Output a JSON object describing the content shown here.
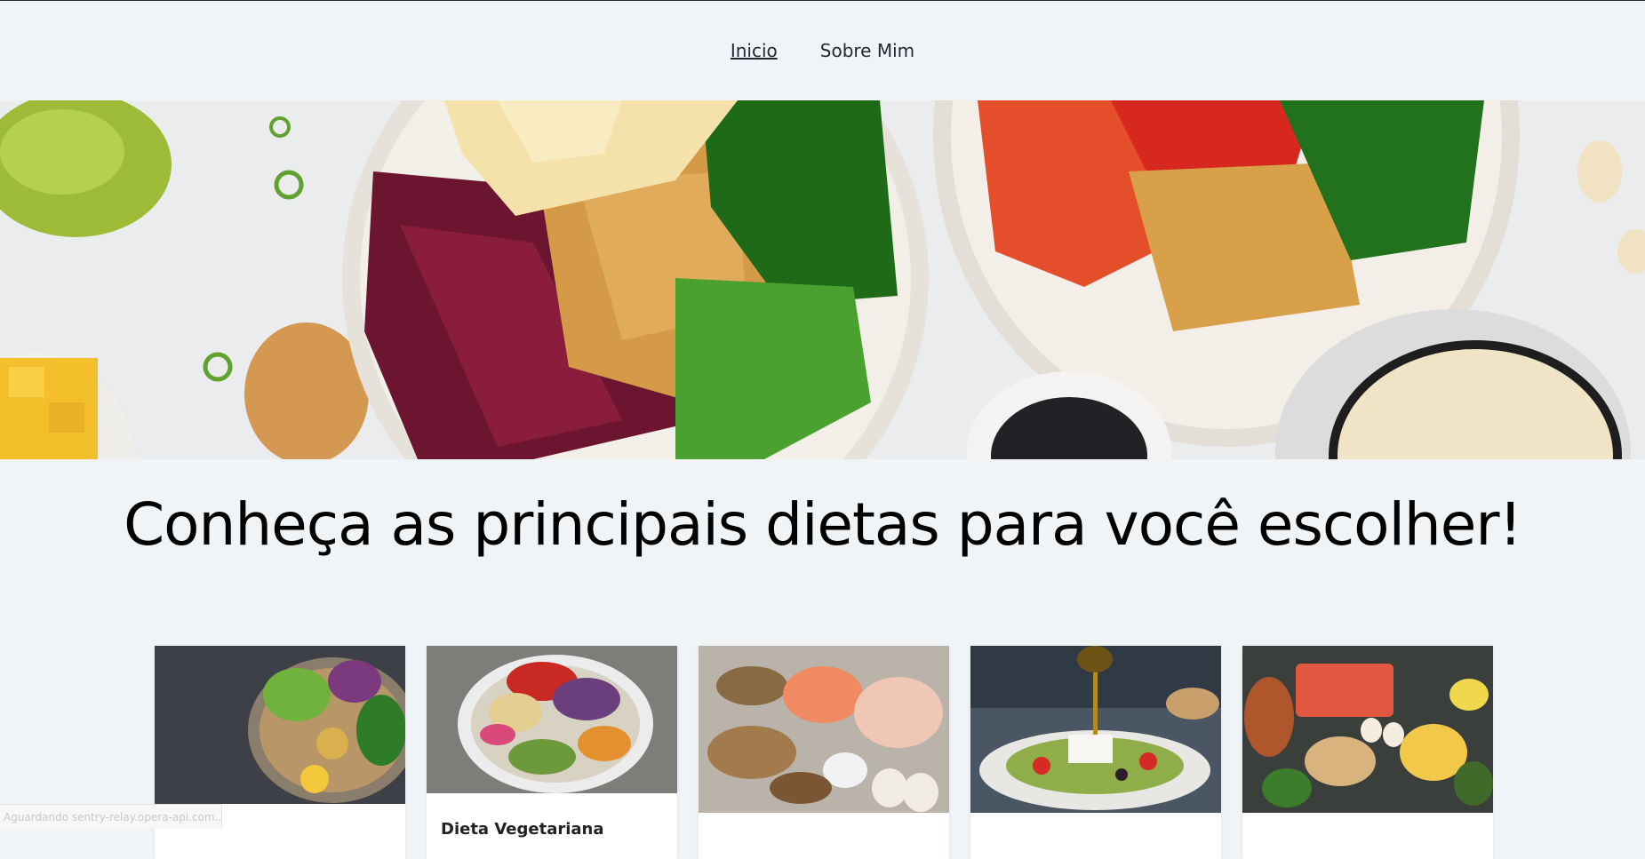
{
  "nav": {
    "items": [
      {
        "label": "Inicio",
        "active": true
      },
      {
        "label": "Sobre Mim",
        "active": false
      }
    ]
  },
  "hero": {
    "image": "poke-bowls-food-photo"
  },
  "main": {
    "headline": "Conheça as principais dietas para você escolher!"
  },
  "cards": [
    {
      "image": "salad-bowl-photo",
      "title": ""
    },
    {
      "image": "vegetable-bowl-photo",
      "title": "Dieta Vegetariana"
    },
    {
      "image": "protein-foods-photo",
      "title": ""
    },
    {
      "image": "greek-salad-olive-oil-photo",
      "title": ""
    },
    {
      "image": "mixed-healthy-foods-photo",
      "title": ""
    }
  ],
  "status": {
    "text": "Aguardando sentry-relay.opera-api.com..."
  },
  "colors": {
    "page_bg": "#f0f4f7",
    "nav_text": "#1f2833",
    "headline": "#000000"
  }
}
